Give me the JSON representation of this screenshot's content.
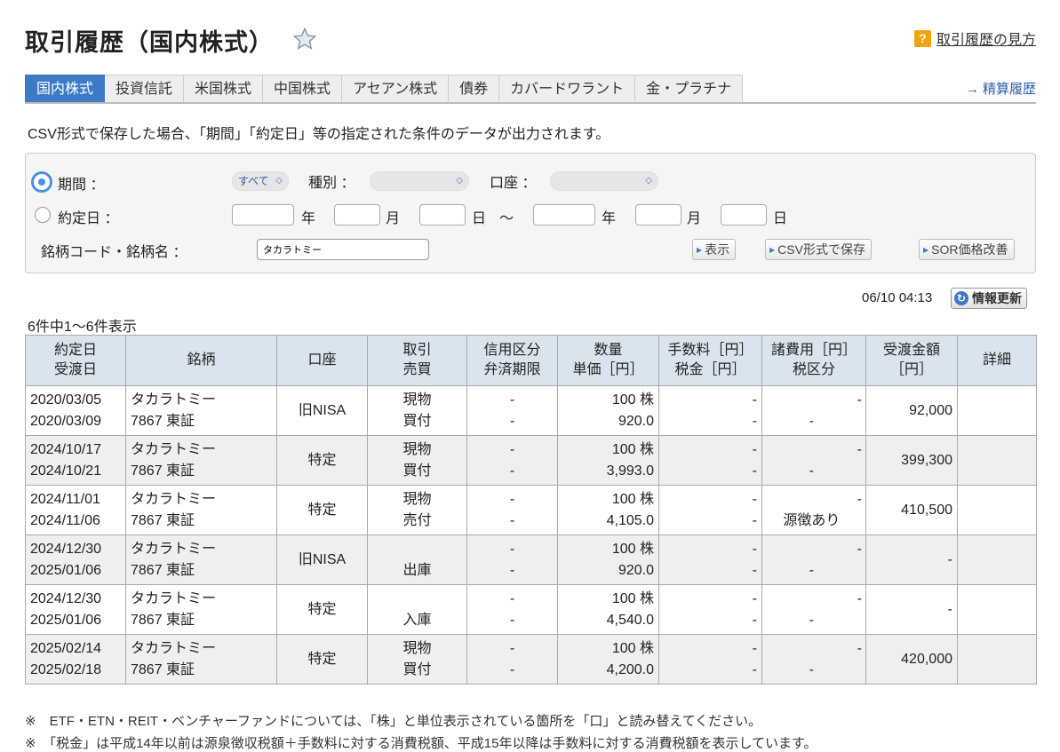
{
  "header": {
    "title": "取引履歴（国内株式）",
    "help_icon_glyph": "?",
    "help_link": "取引履歴の見方"
  },
  "tabs": [
    {
      "label": "国内株式",
      "active": true
    },
    {
      "label": "投資信託"
    },
    {
      "label": "米国株式"
    },
    {
      "label": "中国株式"
    },
    {
      "label": "アセアン株式"
    },
    {
      "label": "債券"
    },
    {
      "label": "カバードワラント"
    },
    {
      "label": "金・プラチナ"
    }
  ],
  "settle_link": "→ 精算履歴",
  "notice": "CSV形式で保存した場合、「期間」「約定日」等の指定された条件のデータが出力されます。",
  "filter": {
    "period_label": "期間 ：",
    "period_value": "すべて",
    "type_label": "種別 ：",
    "type_value": "",
    "account_label": "口座 ：",
    "account_value": "",
    "date_label": "約定日 ：",
    "year": "年",
    "month": "月",
    "day": "日",
    "tilde": "〜",
    "code_label": "銘柄コード・銘柄名 ：",
    "code_value": "タカラトミー",
    "show_btn": "表示",
    "csv_btn": "CSV形式で保存",
    "sor_btn": "SOR価格改善"
  },
  "timestamp": "06/10 04:13",
  "refresh_btn": "情報更新",
  "count_text": "6件中1〜6件表示",
  "table": {
    "headers": {
      "date1": "約定日",
      "date2": "受渡日",
      "name": "銘柄",
      "account": "口座",
      "trade1": "取引",
      "trade2": "売買",
      "credit1": "信用区分",
      "credit2": "弁済期限",
      "qty1": "数量",
      "qty2": "単価［円］",
      "fee1": "手数料［円］",
      "fee2": "税金［円］",
      "misc1": "諸費用［円］",
      "misc2": "税区分",
      "amount1": "受渡金額",
      "amount2": "［円］",
      "detail": "詳細"
    },
    "rows": [
      {
        "trade_date": "2020/03/05",
        "settle_date": "2020/03/09",
        "name": "タカラトミー",
        "code": "7867 東証",
        "account": "旧NISA",
        "trade1": "現物",
        "trade2": "買付",
        "credit1": "-",
        "credit2": "-",
        "qty": "100 株",
        "price": "920.0",
        "fee": "-",
        "tax": "-",
        "misc": "-",
        "tax_class": "-",
        "amount": "92,000"
      },
      {
        "trade_date": "2024/10/17",
        "settle_date": "2024/10/21",
        "name": "タカラトミー",
        "code": "7867 東証",
        "account": "特定",
        "trade1": "現物",
        "trade2": "買付",
        "credit1": "-",
        "credit2": "-",
        "qty": "100 株",
        "price": "3,993.0",
        "fee": "-",
        "tax": "-",
        "misc": "-",
        "tax_class": "-",
        "amount": "399,300"
      },
      {
        "trade_date": "2024/11/01",
        "settle_date": "2024/11/06",
        "name": "タカラトミー",
        "code": "7867 東証",
        "account": "特定",
        "trade1": "現物",
        "trade2": "売付",
        "credit1": "-",
        "credit2": "-",
        "qty": "100 株",
        "price": "4,105.0",
        "fee": "-",
        "tax": "-",
        "misc": "-",
        "tax_class": "源徴あり",
        "amount": "410,500"
      },
      {
        "trade_date": "2024/12/30",
        "settle_date": "2025/01/06",
        "name": "タカラトミー",
        "code": "7867 東証",
        "account": "旧NISA",
        "trade1": "",
        "trade2": "出庫",
        "credit1": "-",
        "credit2": "-",
        "qty": "100 株",
        "price": "920.0",
        "fee": "-",
        "tax": "-",
        "misc": "-",
        "tax_class": "-",
        "amount": "-"
      },
      {
        "trade_date": "2024/12/30",
        "settle_date": "2025/01/06",
        "name": "タカラトミー",
        "code": "7867 東証",
        "account": "特定",
        "trade1": "",
        "trade2": "入庫",
        "credit1": "-",
        "credit2": "-",
        "qty": "100 株",
        "price": "4,540.0",
        "fee": "-",
        "tax": "-",
        "misc": "-",
        "tax_class": "-",
        "amount": "-"
      },
      {
        "trade_date": "2025/02/14",
        "settle_date": "2025/02/18",
        "name": "タカラトミー",
        "code": "7867 東証",
        "account": "特定",
        "trade1": "現物",
        "trade2": "買付",
        "credit1": "-",
        "credit2": "-",
        "qty": "100 株",
        "price": "4,200.0",
        "fee": "-",
        "tax": "-",
        "misc": "-",
        "tax_class": "-",
        "amount": "420,000"
      }
    ]
  },
  "notes": [
    "※　ETF・ETN・REIT・ベンチャーファンドについては、「株」と単位表示されている箇所を「口」と読み替えてください。",
    "※　「税金」は平成14年以前は源泉徴収税額＋手数料に対する消費税額、平成15年以降は手数料に対する消費税額を表示しています。"
  ]
}
